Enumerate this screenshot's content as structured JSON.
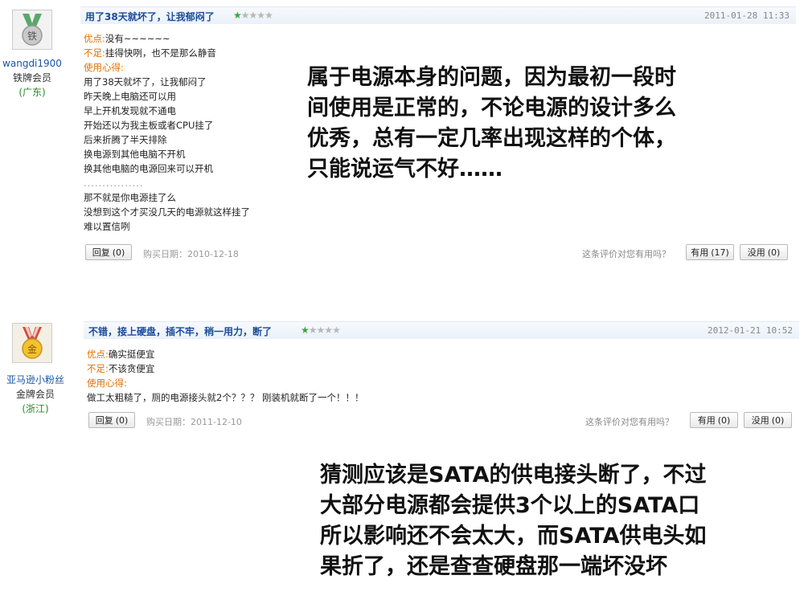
{
  "reviews": [
    {
      "user": {
        "name": "wangdi1900",
        "level": "铁牌会员",
        "region": "(广东)",
        "badge_char": "铁"
      },
      "title": "用了38天就坏了，让我郁闷了",
      "rating": 1,
      "time": "2011-01-28 11:33",
      "pros_label": "优点:",
      "pros": "没有~~~~~~",
      "cons_label": "不足:",
      "cons": "挂得快咧，也不是那么静音",
      "exp_label": "使用心得:",
      "exp_lines": [
        "用了38天就坏了，让我郁闷了",
        "昨天晚上电脑还可以用",
        "早上开机发现就不通电",
        "开始还以为我主板或者CPU挂了",
        "后来折腾了半天排除",
        "换电源到其他电脑不开机",
        "换其他电脑的电源回来可以开机",
        "................",
        "那不就是你电源挂了么",
        "没想到这个才买没几天的电源就这样挂了",
        "难以置信咧"
      ],
      "reply_label": "回复",
      "reply_count": "(0)",
      "buy_date": "购买日期：2010-12-18",
      "helpful_q": "这条评价对您有用吗？",
      "useful_label": "有用",
      "useful_count": "(17)",
      "useless_label": "没用",
      "useless_count": "(0)"
    },
    {
      "user": {
        "name": "亚马逊小粉丝",
        "level": "金牌会员",
        "region": "(浙江)",
        "badge_char": "金"
      },
      "title": "不错，接上硬盘，插不牢，稍一用力，断了",
      "rating": 1,
      "time": "2012-01-21 10:52",
      "pros_label": "优点:",
      "pros": "确实挺便宜",
      "cons_label": "不足:",
      "cons": "不该贪便宜",
      "exp_label": "使用心得:",
      "exp_lines": [
        "做工太粗糙了，厕的电源接头就2个？？？ 刚装机就断了一个！！！"
      ],
      "reply_label": "回复",
      "reply_count": "(0)",
      "buy_date": "购买日期：2011-12-10",
      "helpful_q": "这条评价对您有用吗？",
      "useful_label": "有用",
      "useful_count": "(0)",
      "useless_label": "没用",
      "useless_count": "(0)"
    }
  ],
  "annotations": [
    {
      "lines": [
        "属于电源本身的问题，因为最初一段时",
        "间使用是正常的，不论电源的设计多么",
        "优秀，总有一定几率出现这样的个体，",
        "只能说运气不好……"
      ]
    },
    {
      "lines": [
        "猜测应该是SATA的供电接头断了，不过",
        "大部分电源都会提供3个以上的SATA口",
        "所以影响还不会太大，而SATA供电头如",
        "果折了，还是查查硬盘那一端坏没坏"
      ]
    }
  ],
  "colors": {
    "title_blue": "#1a4b99",
    "label_orange": "#e07000",
    "star_green": "#3aa63a",
    "region_green": "#2a8a2a"
  }
}
